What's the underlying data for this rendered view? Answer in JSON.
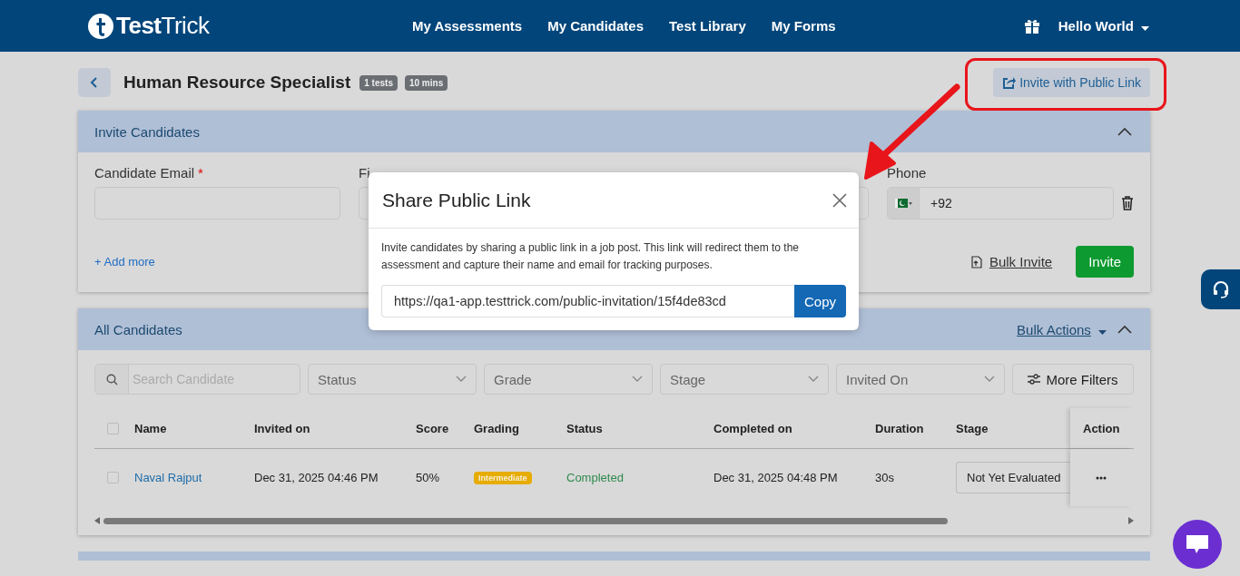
{
  "header": {
    "logo_bold": "Test",
    "logo_light": "Trick",
    "nav": [
      "My Assessments",
      "My Candidates",
      "Test Library",
      "My Forms"
    ],
    "user": "Hello World"
  },
  "page": {
    "title": "Human Resource Specialist",
    "badges": [
      "1 tests",
      "10 mins"
    ],
    "public_link_button": "Invite with Public Link"
  },
  "invite_panel": {
    "title": "Invite Candidates",
    "expanded": true,
    "fields": [
      {
        "kind": "text",
        "label": "Candidate Email",
        "required_mark": "*"
      },
      {
        "kind": "text",
        "label": "Fi"
      },
      {
        "kind": "text"
      },
      {
        "kind": "phone",
        "label": "Phone",
        "value": "+92"
      }
    ],
    "add_more": "+ Add more",
    "bulk_invite": "Bulk Invite",
    "invite": "Invite"
  },
  "candidates_panel": {
    "title": "All Candidates",
    "bulk_actions": "Bulk Actions",
    "expanded": true,
    "all_selected": false,
    "search_placeholder": "Search Candidate",
    "filters": [
      "Status",
      "Grade",
      "Stage",
      "Invited On"
    ],
    "more_filters": "More Filters",
    "columns": [
      "Name",
      "Invited on",
      "Score",
      "Grading",
      "Status",
      "Completed on",
      "Duration",
      "Stage",
      "Action"
    ],
    "rows": [
      {
        "selected": false,
        "name": "Naval Rajput",
        "invited_on": "Dec 31, 2025 04:46 PM",
        "score": "50%",
        "grading": "Intermediate",
        "status": "Completed",
        "completed_on": "Dec 31, 2025 04:48 PM",
        "duration": "30s",
        "stage": "Not Yet Evaluated"
      }
    ]
  },
  "modal": {
    "title": "Share Public Link",
    "description": "Invite candidates by sharing a public link in a job post. This link will redirect them to the assessment and capture their name and email for tracking purposes.",
    "link": "https://qa1-app.testtrick.com/public-invitation/15f4de83cd",
    "copy": "Copy"
  }
}
